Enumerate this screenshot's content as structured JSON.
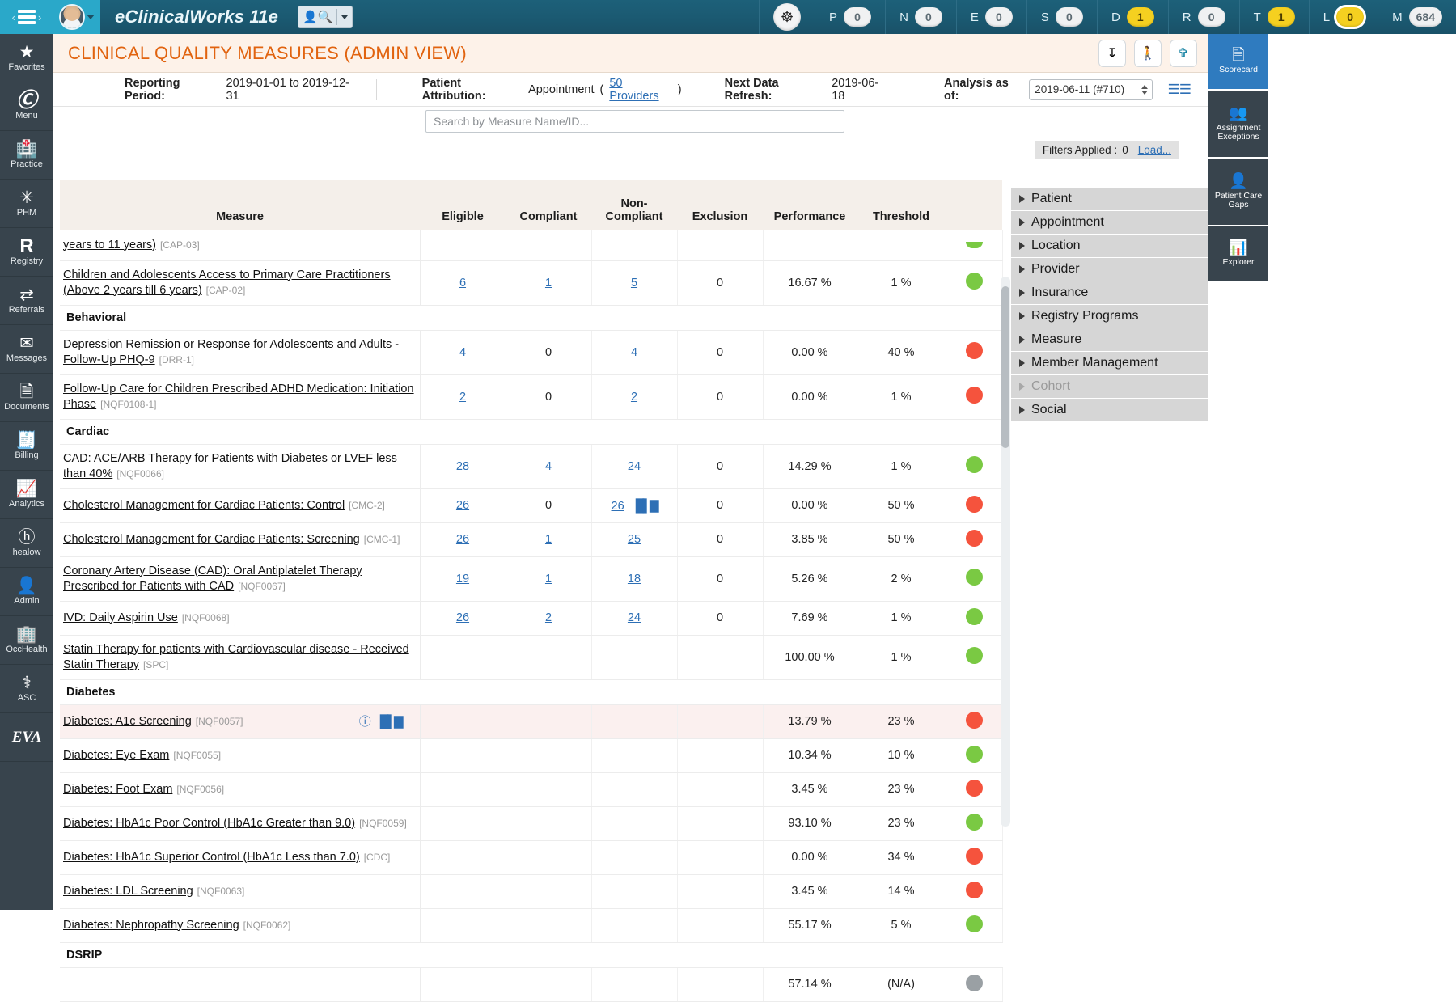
{
  "topbar": {
    "app_title": "eClinicalWorks 11e",
    "hamburger_icon": "hamburger-icon",
    "prev_icon": "‹",
    "next_icon": "›",
    "patient_search_icon": "patient-search-icon",
    "sync_icon": "↻",
    "badges": [
      {
        "letter": "P",
        "count": "0",
        "style": "grey"
      },
      {
        "letter": "N",
        "count": "0",
        "style": "grey"
      },
      {
        "letter": "E",
        "count": "0",
        "style": "grey"
      },
      {
        "letter": "S",
        "count": "0",
        "style": "grey"
      },
      {
        "letter": "D",
        "count": "1",
        "style": "yellow"
      },
      {
        "letter": "R",
        "count": "0",
        "style": "grey"
      },
      {
        "letter": "T",
        "count": "1",
        "style": "yellow"
      },
      {
        "letter": "L",
        "count": "0",
        "style": "yellow-ring"
      },
      {
        "letter": "M",
        "count": "684",
        "style": "grey"
      }
    ]
  },
  "leftnav": {
    "items": [
      {
        "label": "Favorites",
        "icon": "star-icon",
        "glyph": "★"
      },
      {
        "label": "Menu",
        "icon": "ecw-logo-icon",
        "glyph": "Ⓖ"
      },
      {
        "label": "Practice",
        "icon": "hospital-icon",
        "glyph": "Ἶ5"
      },
      {
        "label": "PHM",
        "icon": "network-icon",
        "glyph": "✳"
      },
      {
        "label": "Registry",
        "icon": "registry-r-icon",
        "glyph": "R"
      },
      {
        "label": "Referrals",
        "icon": "arrows-icon",
        "glyph": "⇄"
      },
      {
        "label": "Messages",
        "icon": "envelope-icon",
        "glyph": "✉"
      },
      {
        "label": "Documents",
        "icon": "document-icon",
        "glyph": "὜E"
      },
      {
        "label": "Billing",
        "icon": "receipt-icon",
        "glyph": "ᾟE"
      },
      {
        "label": "Analytics",
        "icon": "bar-chart-icon",
        "glyph": "Ὄ8"
      },
      {
        "label": "healow",
        "icon": "healow-icon",
        "glyph": "ⓗ"
      },
      {
        "label": "Admin",
        "icon": "user-icon",
        "glyph": "὆4"
      },
      {
        "label": "OccHealth",
        "icon": "hospital-icon",
        "glyph": "Ἶ2"
      },
      {
        "label": "ASC",
        "icon": "asc-icon",
        "glyph": "⚕"
      },
      {
        "label": "EVA",
        "icon": "eva-logo-icon",
        "glyph": "EVA"
      }
    ]
  },
  "header": {
    "page_title": "CLINICAL QUALITY MEASURES (ADMIN VIEW)",
    "action_icons": [
      {
        "name": "export-icon",
        "glyph": "⤓"
      },
      {
        "name": "person-icon",
        "glyph": "Ὣ6"
      },
      {
        "name": "settings-icon",
        "glyph": "⚒"
      }
    ]
  },
  "meta": {
    "reporting_period_label": "Reporting Period:",
    "reporting_period_value": "2019-01-01 to 2019-12-31",
    "patient_attribution_label": "Patient Attribution:",
    "patient_attribution_value": "Appointment",
    "providers_link": "50 Providers",
    "next_refresh_label": "Next Data Refresh:",
    "next_refresh_value": "2019-06-18",
    "analysis_label": "Analysis as of:",
    "analysis_value": "2019-06-11 (#710)",
    "list_icon": "list-view-icon"
  },
  "search": {
    "placeholder": "Search by Measure Name/ID...",
    "value": ""
  },
  "filters_bar": {
    "label": "Filters Applied :",
    "count": "0",
    "load_label": "Load..."
  },
  "table": {
    "columns": [
      "Measure",
      "Eligible",
      "Compliant",
      "Non-Compliant",
      "Exclusion",
      "Performance",
      "Threshold"
    ],
    "rows": [
      {
        "type": "measure",
        "name": "years to 11 years)",
        "code": "[CAP-03]",
        "eligible": "",
        "compliant": "",
        "noncompliant": "",
        "exclusion": "",
        "performance": "",
        "threshold": "",
        "status": "half-green",
        "partial": true
      },
      {
        "type": "measure",
        "name": "Children and Adolescents Access to Primary Care Practitioners (Above 2 years till 6 years)",
        "code": "[CAP-02]",
        "eligible": "6",
        "compliant": "1",
        "noncompliant": "5",
        "exclusion": "0",
        "performance": "16.67 %",
        "threshold": "1 %",
        "status": "green"
      },
      {
        "type": "group",
        "name": "Behavioral"
      },
      {
        "type": "measure",
        "name": "Depression Remission or Response for Adolescents and Adults - Follow-Up PHQ-9",
        "code": "[DRR-1]",
        "eligible": "4",
        "compliant": "0",
        "noncompliant": "4",
        "exclusion": "0",
        "performance": "0.00 %",
        "threshold": "40 %",
        "status": "red"
      },
      {
        "type": "measure",
        "name": "Follow-Up Care for Children Prescribed ADHD Medication: Initiation Phase",
        "code": "[NQF0108-1]",
        "eligible": "2",
        "compliant": "0",
        "noncompliant": "2",
        "exclusion": "0",
        "performance": "0.00 %",
        "threshold": "1 %",
        "status": "red"
      },
      {
        "type": "group",
        "name": "Cardiac"
      },
      {
        "type": "measure",
        "name": "CAD: ACE/ARB Therapy for Patients with Diabetes or LVEF less than 40%",
        "code": "[NQF0066]",
        "eligible": "28",
        "compliant": "4",
        "noncompliant": "24",
        "exclusion": "0",
        "performance": "14.29 %",
        "threshold": "1 %",
        "status": "green"
      },
      {
        "type": "measure",
        "name": "Cholesterol Management for Cardiac Patients: Control",
        "code": "[CMC-2]",
        "eligible": "26",
        "compliant": "0",
        "noncompliant": "26",
        "exclusion": "0",
        "performance": "0.00 %",
        "threshold": "50 %",
        "status": "red",
        "nc_chart_icon": true
      },
      {
        "type": "measure",
        "name": "Cholesterol Management for Cardiac Patients: Screening",
        "code": "[CMC-1]",
        "eligible": "26",
        "compliant": "1",
        "noncompliant": "25",
        "exclusion": "0",
        "performance": "3.85 %",
        "threshold": "50 %",
        "status": "red"
      },
      {
        "type": "measure",
        "name": "Coronary Artery Disease (CAD): Oral Antiplatelet Therapy Prescribed for Patients with CAD",
        "code": "[NQF0067]",
        "eligible": "19",
        "compliant": "1",
        "noncompliant": "18",
        "exclusion": "0",
        "performance": "5.26 %",
        "threshold": "2 %",
        "status": "green"
      },
      {
        "type": "measure",
        "name": "IVD: Daily Aspirin Use",
        "code": "[NQF0068]",
        "eligible": "26",
        "compliant": "2",
        "noncompliant": "24",
        "exclusion": "0",
        "performance": "7.69 %",
        "threshold": "1 %",
        "status": "green"
      },
      {
        "type": "measure",
        "name": "Statin Therapy for patients with Cardiovascular disease - Received Statin Therapy",
        "code": "[SPC]",
        "eligible": "",
        "compliant": "",
        "noncompliant": "",
        "exclusion": "",
        "performance": "100.00 %",
        "threshold": "1 %",
        "status": "green"
      },
      {
        "type": "group",
        "name": "Diabetes"
      },
      {
        "type": "measure",
        "name": "Diabetes: A1c Screening",
        "code": "[NQF0057]",
        "eligible": "",
        "compliant": "",
        "noncompliant": "",
        "exclusion": "",
        "performance": "13.79 %",
        "threshold": "23 %",
        "status": "red",
        "highlight": true,
        "row_icons": true
      },
      {
        "type": "measure",
        "name": "Diabetes: Eye Exam",
        "code": "[NQF0055]",
        "eligible": "",
        "compliant": "",
        "noncompliant": "",
        "exclusion": "",
        "performance": "10.34 %",
        "threshold": "10 %",
        "status": "green"
      },
      {
        "type": "measure",
        "name": "Diabetes: Foot Exam",
        "code": "[NQF0056]",
        "eligible": "",
        "compliant": "",
        "noncompliant": "",
        "exclusion": "",
        "performance": "3.45 %",
        "threshold": "23 %",
        "status": "red"
      },
      {
        "type": "measure",
        "name": "Diabetes: HbA1c Poor Control (HbA1c Greater than 9.0)",
        "code": "[NQF0059]",
        "eligible": "",
        "compliant": "",
        "noncompliant": "",
        "exclusion": "",
        "performance": "93.10 %",
        "threshold": "23 %",
        "status": "green"
      },
      {
        "type": "measure",
        "name": "Diabetes: HbA1c Superior Control (HbA1c Less than 7.0)",
        "code": "[CDC]",
        "eligible": "",
        "compliant": "",
        "noncompliant": "",
        "exclusion": "",
        "performance": "0.00 %",
        "threshold": "34 %",
        "status": "red"
      },
      {
        "type": "measure",
        "name": "Diabetes: LDL Screening",
        "code": "[NQF0063]",
        "eligible": "",
        "compliant": "",
        "noncompliant": "",
        "exclusion": "",
        "performance": "3.45 %",
        "threshold": "14 %",
        "status": "red"
      },
      {
        "type": "measure",
        "name": "Diabetes: Nephropathy Screening",
        "code": "[NQF0062]",
        "eligible": "",
        "compliant": "",
        "noncompliant": "",
        "exclusion": "",
        "performance": "55.17 %",
        "threshold": "5 %",
        "status": "green"
      },
      {
        "type": "group",
        "name": "DSRIP"
      },
      {
        "type": "measure",
        "name": "",
        "code": "",
        "eligible": "",
        "compliant": "",
        "noncompliant": "",
        "exclusion": "",
        "performance": "57.14 %",
        "threshold": "(N/A)",
        "status": "grey",
        "clipped": true
      }
    ]
  },
  "filter_panel": {
    "items": [
      {
        "label": "Patient",
        "disabled": false
      },
      {
        "label": "Appointment",
        "disabled": false
      },
      {
        "label": "Location",
        "disabled": false
      },
      {
        "label": "Provider",
        "disabled": false
      },
      {
        "label": "Insurance",
        "disabled": false
      },
      {
        "label": "Registry Programs",
        "disabled": false
      },
      {
        "label": "Measure",
        "disabled": false
      },
      {
        "label": "Member Management",
        "disabled": false
      },
      {
        "label": "Cohort",
        "disabled": true
      },
      {
        "label": "Social",
        "disabled": false
      }
    ]
  },
  "rightrail": {
    "tabs": [
      {
        "label": "Scorecard",
        "icon": "scorecard-icon",
        "glyph": "Ὄ4",
        "active": true
      },
      {
        "label": "Assignment Exceptions",
        "icon": "assignment-exceptions-icon",
        "glyph": "὆5",
        "active": false
      },
      {
        "label": "Patient Care Gaps",
        "icon": "patient-care-gaps-icon",
        "glyph": "὆4",
        "active": false
      },
      {
        "label": "Explorer",
        "icon": "explorer-chart-icon",
        "glyph": "ὌA",
        "active": false
      }
    ]
  },
  "colors": {
    "accent_orange": "#e1630f",
    "link_blue": "#2d6fb5",
    "status_green": "#7ac943",
    "status_red": "#f5533d",
    "status_grey": "#9aa0a4",
    "topbar_teal": "#1b5a72",
    "nav_dark": "#38444d"
  }
}
